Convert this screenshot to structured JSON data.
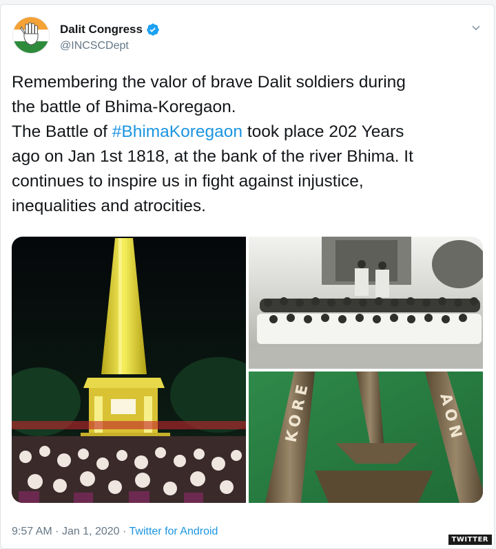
{
  "tweet": {
    "author_name": "Dalit Congress",
    "author_handle": "@INCSCDept",
    "text_lines": [
      [
        "Remembering the valor of brave Dalit soldiers during"
      ],
      [
        "the battle of Bhima-Koregaon."
      ],
      [
        "The Battle of ",
        "#BhimaKoregaon",
        " took place 202 Years"
      ],
      [
        "ago on Jan 1st 1818, at the bank of the river Bhima. It"
      ],
      [
        "continues to inspire us in fight against injustice,"
      ],
      [
        "inequalities and atrocities."
      ]
    ],
    "meta": {
      "time": "9:57 AM",
      "date": "Jan 1, 2020",
      "source": "Twitter for Android"
    },
    "media": {
      "tower_text": "",
      "emblem_left_text": "KORE",
      "emblem_right_text": "AON"
    }
  },
  "watermark": "TWITTER",
  "colors": {
    "link": "#1b95e0",
    "secondary": "#657786",
    "primary": "#14171a",
    "verified": "#1da1f2",
    "saffron": "#f4a235",
    "india_green": "#2e8b3c"
  },
  "icons": {
    "avatar": "congress-hand-logo",
    "verified": "verified-badge-icon",
    "menu": "chevron-down-icon"
  }
}
